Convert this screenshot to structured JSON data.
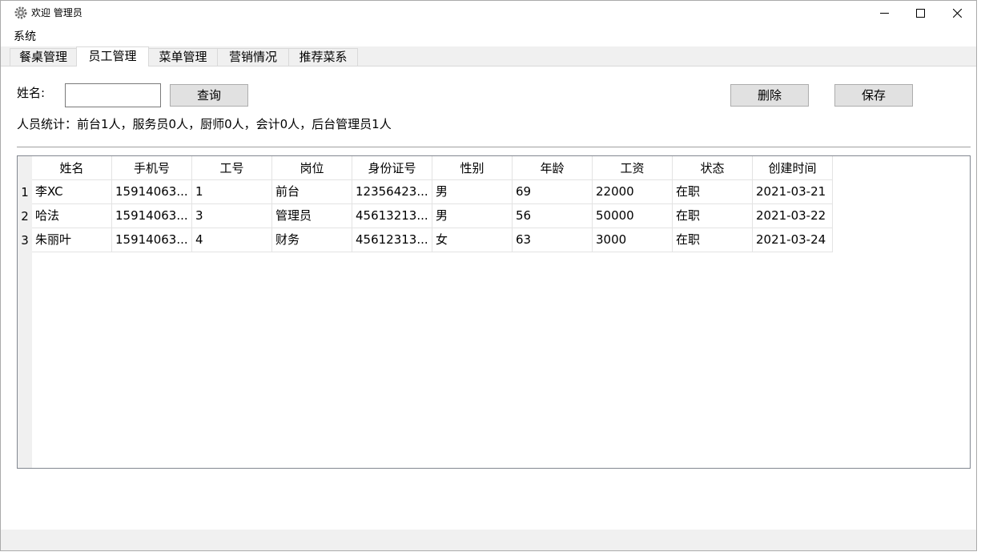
{
  "window": {
    "title": "欢迎 管理员"
  },
  "menu": {
    "system": "系统"
  },
  "tabs": [
    "餐桌管理",
    "员工管理",
    "菜单管理",
    "营销情况",
    "推荐菜系"
  ],
  "active_tab": 1,
  "search": {
    "label": "姓名:",
    "value": "",
    "query_button": "查询"
  },
  "actions": {
    "delete": "删除",
    "save": "保存"
  },
  "stats": "人员统计：前台1人，服务员0人，厨师0人，会计0人，后台管理员1人",
  "table": {
    "columns": [
      "姓名",
      "手机号",
      "工号",
      "岗位",
      "身份证号",
      "性别",
      "年龄",
      "工资",
      "状态",
      "创建时间"
    ],
    "rows": [
      {
        "num": "1",
        "cells": [
          "李XC",
          "15914063...",
          "1",
          "前台",
          "12356423...",
          "男",
          "69",
          "22000",
          "在职",
          "2021-03-21"
        ]
      },
      {
        "num": "2",
        "cells": [
          "哈法",
          "15914063...",
          "3",
          "管理员",
          "45613213...",
          "男",
          "56",
          "50000",
          "在职",
          "2021-03-22"
        ]
      },
      {
        "num": "3",
        "cells": [
          "朱丽叶",
          "15914063...",
          "4",
          "财务",
          "45612313...",
          "女",
          "63",
          "3000",
          "在职",
          "2021-03-24"
        ]
      }
    ]
  }
}
